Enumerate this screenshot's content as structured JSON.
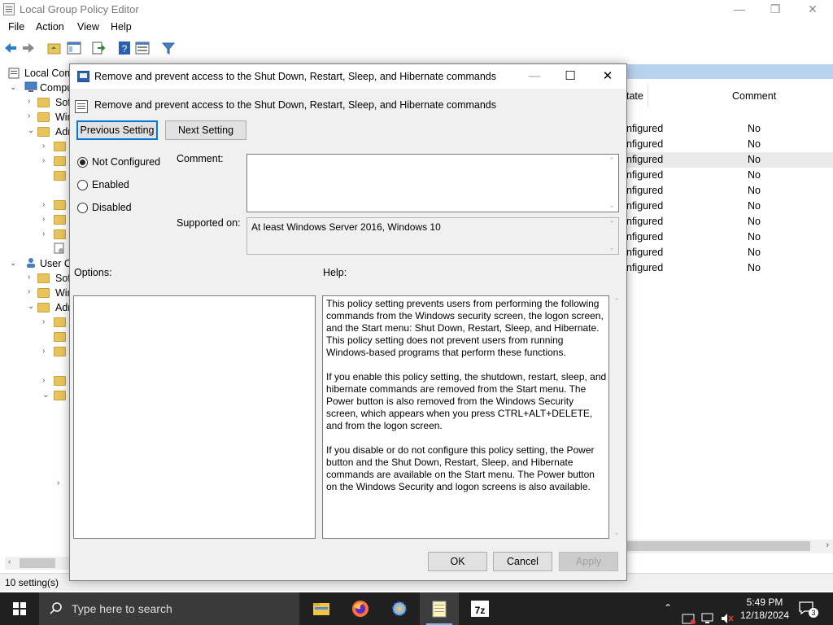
{
  "main_window": {
    "title": "Local Group Policy Editor",
    "menu": [
      "File",
      "Action",
      "View",
      "Help"
    ],
    "tree_items": [
      {
        "label": "Local Com",
        "expander": ""
      },
      {
        "label": "Compu",
        "expander": "⌄"
      },
      {
        "label": "Sof",
        "expander": "›"
      },
      {
        "label": "Win",
        "expander": "›"
      },
      {
        "label": "Adr",
        "expander": "⌄"
      },
      {
        "label": "User C",
        "expander": "⌄"
      },
      {
        "label": "Sof",
        "expander": "›"
      },
      {
        "label": "Win",
        "expander": "›"
      },
      {
        "label": "Adr",
        "expander": "⌄"
      }
    ],
    "list": {
      "col_state": "tate",
      "col_comment": "Comment",
      "rows": [
        {
          "state": "nfigured",
          "comment": "No"
        },
        {
          "state": "nfigured",
          "comment": "No"
        },
        {
          "state": "nfigured",
          "comment": "No"
        },
        {
          "state": "nfigured",
          "comment": "No"
        },
        {
          "state": "nfigured",
          "comment": "No"
        },
        {
          "state": "nfigured",
          "comment": "No"
        },
        {
          "state": "nfigured",
          "comment": "No"
        },
        {
          "state": "nfigured",
          "comment": "No"
        },
        {
          "state": "nfigured",
          "comment": "No"
        },
        {
          "state": "nfigured",
          "comment": "No"
        }
      ]
    },
    "status": "10 setting(s)"
  },
  "dialog": {
    "title": "Remove and prevent access to the Shut Down, Restart, Sleep, and Hibernate commands",
    "policy_name": "Remove and prevent access to the Shut Down, Restart, Sleep, and Hibernate commands",
    "prev_button": "Previous Setting",
    "next_button": "Next Setting",
    "radio_not_configured": "Not Configured",
    "radio_enabled": "Enabled",
    "radio_disabled": "Disabled",
    "selected_option": "Not Configured",
    "comment_label": "Comment:",
    "comment_value": "",
    "supported_label": "Supported on:",
    "supported_value": "At least Windows Server 2016, Windows 10",
    "options_label": "Options:",
    "help_label": "Help:",
    "help_p1": "This policy setting prevents users from performing the following commands from the Windows security screen, the logon screen, and the Start menu: Shut Down, Restart, Sleep, and Hibernate. This policy setting does not prevent users from running Windows-based programs that perform these functions.",
    "help_p2": "If you enable this policy setting, the shutdown, restart, sleep, and hibernate commands are removed from the Start menu. The Power button is also removed from the Windows Security screen, which appears when you press CTRL+ALT+DELETE, and from the logon screen.",
    "help_p3": "If you disable or do not configure this policy setting, the Power button and the Shut Down, Restart, Sleep, and Hibernate commands are available on the Start menu. The Power button on the Windows Security and logon screens is also available.",
    "ok": "OK",
    "cancel": "Cancel",
    "apply": "Apply"
  },
  "taskbar": {
    "search_placeholder": "Type here to search",
    "time": "5:49 PM",
    "date": "12/18/2024",
    "notification_count": "3",
    "app_7zip_label": "7z"
  },
  "colors": {
    "accent": "#0078d7",
    "taskbar": "#202020",
    "folder": "#e8c45c",
    "list_header": "#b8d1ec"
  }
}
